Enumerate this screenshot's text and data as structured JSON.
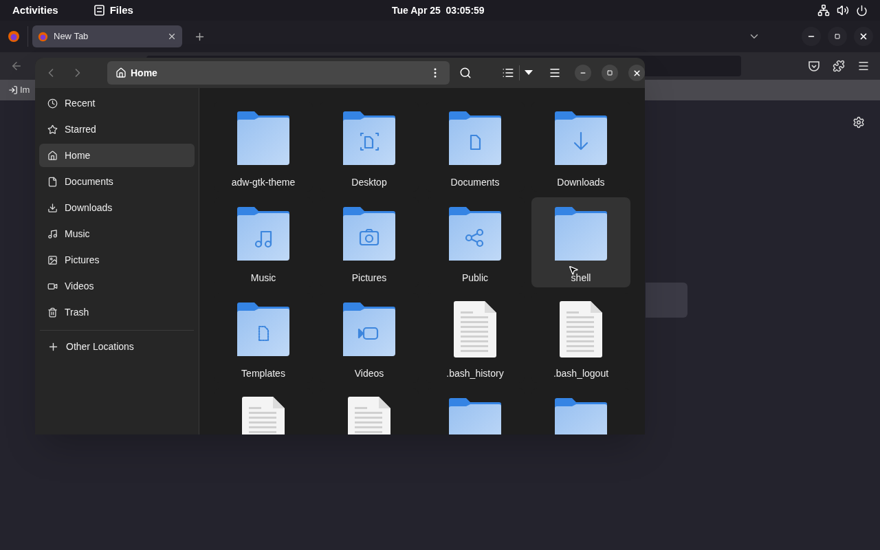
{
  "top_bar": {
    "activities": "Activities",
    "app": "Files",
    "clock": "Tue Apr 25  03:05:59"
  },
  "browser": {
    "tabs": [
      {
        "title": "New Tab",
        "selected": true
      }
    ],
    "bookmarks": [
      {
        "label": "Im"
      }
    ]
  },
  "files": {
    "path": "Home",
    "sidebar": [
      {
        "kind": "recent",
        "label": "Recent",
        "selected": false
      },
      {
        "kind": "starred",
        "label": "Starred",
        "selected": false
      },
      {
        "kind": "home",
        "label": "Home",
        "selected": true
      },
      {
        "kind": "documents",
        "label": "Documents",
        "selected": false
      },
      {
        "kind": "downloads",
        "label": "Downloads",
        "selected": false
      },
      {
        "kind": "music",
        "label": "Music",
        "selected": false
      },
      {
        "kind": "pictures",
        "label": "Pictures",
        "selected": false
      },
      {
        "kind": "videos",
        "label": "Videos",
        "selected": false
      },
      {
        "kind": "trash",
        "label": "Trash",
        "selected": false
      }
    ],
    "other_locations": "Other Locations",
    "items": [
      {
        "kind": "folder",
        "name": "adw-gtk-theme",
        "hovered": false
      },
      {
        "kind": "desktop-folder",
        "name": "Desktop",
        "hovered": false
      },
      {
        "kind": "documents-folder",
        "name": "Documents",
        "hovered": false
      },
      {
        "kind": "downloads-folder",
        "name": "Downloads",
        "hovered": false
      },
      {
        "kind": "music-folder",
        "name": "Music",
        "hovered": false
      },
      {
        "kind": "pictures-folder",
        "name": "Pictures",
        "hovered": false
      },
      {
        "kind": "public-folder",
        "name": "Public",
        "hovered": false
      },
      {
        "kind": "folder",
        "name": "shell",
        "hovered": true
      },
      {
        "kind": "templates-folder",
        "name": "Templates",
        "hovered": false
      },
      {
        "kind": "videos-folder",
        "name": "Videos",
        "hovered": false
      },
      {
        "kind": "text-file",
        "name": ".bash_history",
        "hovered": false
      },
      {
        "kind": "text-file",
        "name": ".bash_logout",
        "hovered": false
      },
      {
        "kind": "text-file",
        "hovered": false
      },
      {
        "kind": "text-file",
        "hovered": false
      },
      {
        "kind": "folder",
        "hovered": false
      },
      {
        "kind": "folder",
        "hovered": false
      }
    ]
  }
}
